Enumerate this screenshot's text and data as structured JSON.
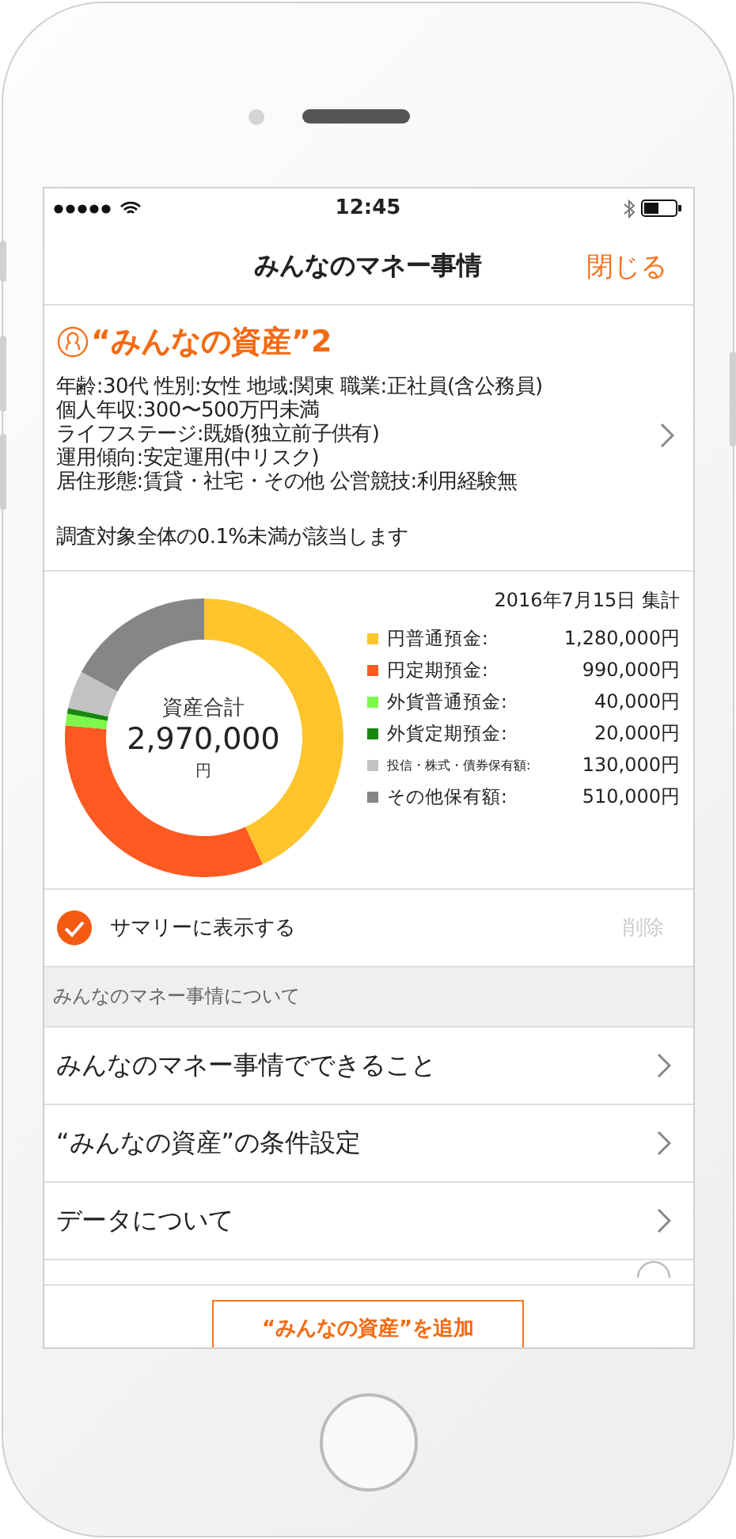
{
  "status_bar": {
    "time": "12:45"
  },
  "nav": {
    "title": "みんなのマネー事情",
    "close": "閉じる"
  },
  "profile": {
    "title": "“みんなの資産”2",
    "lines": [
      "年齢:30代 性別:女性 地域:関東 職業:正社員(含公務員)",
      "個人年収:300〜500万円未満",
      "ライフステージ:既婚(独立前子供有)",
      "運用傾向:安定運用(中リスク)",
      "居住形態:賃貸・社宅・その他 公営競技:利用経験無"
    ],
    "note": "調査対象全体の0.1%未満が該当します"
  },
  "summary": {
    "date": "2016年7月15日 集計",
    "total_label": "資産合計",
    "total": "2,970,000",
    "unit": "円",
    "legend": [
      {
        "label": "円普通預金:",
        "amount": "1,280,000円",
        "color": "#fdc52b",
        "kind": "normal"
      },
      {
        "label": "円定期預金:",
        "amount": "990,000円",
        "color": "#fd5a22",
        "kind": "normal"
      },
      {
        "label": "外貨普通預金:",
        "amount": "40,000円",
        "color": "#7ef84a",
        "kind": "normal"
      },
      {
        "label": "外貨定期預金:",
        "amount": "20,000円",
        "color": "#18870f",
        "kind": "normal"
      },
      {
        "label": "投信・株式・債券保有額:",
        "amount": "130,000円",
        "color": "#c2c2c2",
        "kind": "small"
      },
      {
        "label": "その他保有額:",
        "amount": "510,000円",
        "color": "#868686",
        "kind": "normal"
      }
    ],
    "chart_data": {
      "type": "donut",
      "values": [
        43.1,
        33.33,
        1.35,
        0.67,
        4.38,
        17.17
      ]
    }
  },
  "display_option": {
    "label": "サマリーに表示する",
    "checked": true,
    "delete": "削除",
    "disabled": true
  },
  "about": {
    "header": "みんなのマネー事情について",
    "items": [
      {
        "label": "みんなのマネー事情でできること"
      },
      {
        "label": "“みんなの資産”の条件設定"
      },
      {
        "label": "データについて"
      }
    ]
  },
  "add_button": "“みんなの資産”を追加"
}
